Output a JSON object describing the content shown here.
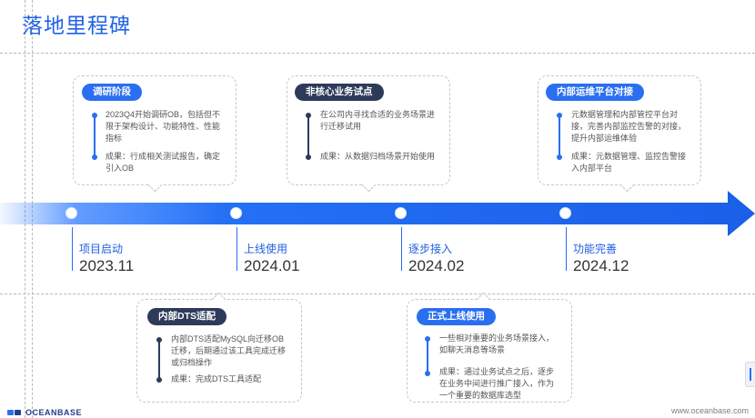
{
  "page_title": "落地里程碑",
  "milestones": [
    {
      "label": "项目启动",
      "date": "2023.11"
    },
    {
      "label": "上线使用",
      "date": "2024.01"
    },
    {
      "label": "逐步接入",
      "date": "2024.02"
    },
    {
      "label": "功能完善",
      "date": "2024.12"
    }
  ],
  "cards": {
    "research": {
      "tag": "调研阶段",
      "items": [
        "2023Q4开始调研OB，包括但不限于架构设计、功能特性、性能指标",
        "成果：行成相关测试报告，确定引入OB"
      ]
    },
    "dts": {
      "tag": "内部DTS适配",
      "items": [
        "内部DTS适配MySQL向迁移OB迁移，后期通过该工具完成迁移或归档操作",
        "成果：完成DTS工具适配"
      ]
    },
    "noncore": {
      "tag": "非核心业务试点",
      "items": [
        "在公司内寻找合适的业务场景进行迁移试用",
        "成果：从数据归档场景开始使用"
      ]
    },
    "official": {
      "tag": "正式上线使用",
      "items": [
        "一些相对重要的业务场景接入，如聊天消息等场景",
        "成果：通过业务试点之后，逐步在业务中间进行推广接入，作为一个重要的数据库选型"
      ]
    },
    "ops": {
      "tag": "内部运维平台对接",
      "items": [
        "元数据管理和内部管控平台对接，完善内部监控告警的对接，提升内部运维体验",
        "成果：元数据管理、监控告警接入内部平台"
      ]
    }
  },
  "footer": {
    "logo_text": "OCEANBASE",
    "website": "www.oceanbase.com"
  },
  "colors": {
    "accent": "#2a6ff0",
    "title": "#1f63e6",
    "dark_tag": "#2e3a59"
  }
}
